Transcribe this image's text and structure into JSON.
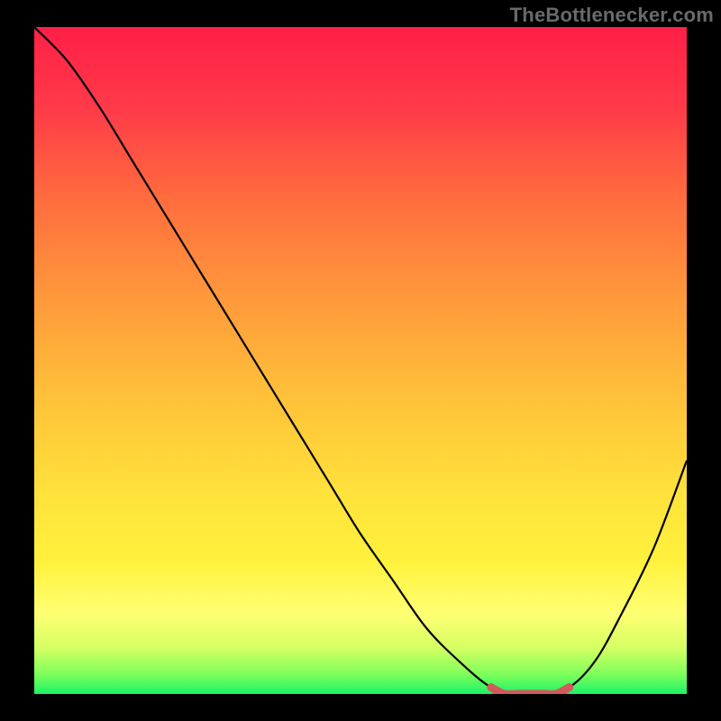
{
  "watermark": "TheBottlenecker.com",
  "chart_data": {
    "type": "line",
    "title": "",
    "xlabel": "",
    "ylabel": "",
    "xlim": [
      0,
      100
    ],
    "ylim": [
      0,
      100
    ],
    "series": [
      {
        "name": "bottleneck-curve",
        "x": [
          0,
          5,
          10,
          15,
          20,
          25,
          30,
          35,
          40,
          45,
          50,
          55,
          60,
          65,
          70,
          74,
          78,
          82,
          86,
          90,
          95,
          100
        ],
        "y": [
          100,
          95,
          88,
          80,
          72,
          64,
          56,
          48,
          40,
          32,
          24,
          17,
          10,
          5,
          1,
          0,
          0,
          1,
          5,
          12,
          22,
          35
        ]
      },
      {
        "name": "highlight-flat-bottom",
        "x": [
          70,
          72,
          74,
          76,
          78,
          80,
          82
        ],
        "y": [
          1,
          0,
          0,
          0,
          0,
          0,
          1
        ]
      }
    ],
    "gradient_stops": [
      {
        "pos": 0.0,
        "color": "#ff1f47"
      },
      {
        "pos": 0.12,
        "color": "#ff3a49"
      },
      {
        "pos": 0.25,
        "color": "#ff6a3e"
      },
      {
        "pos": 0.4,
        "color": "#ff973b"
      },
      {
        "pos": 0.55,
        "color": "#ffc03a"
      },
      {
        "pos": 0.7,
        "color": "#ffe23b"
      },
      {
        "pos": 0.8,
        "color": "#fff13c"
      },
      {
        "pos": 0.88,
        "color": "#ffff73"
      },
      {
        "pos": 0.93,
        "color": "#d6ff63"
      },
      {
        "pos": 0.97,
        "color": "#7fff5a"
      },
      {
        "pos": 1.0,
        "color": "#1cf268"
      }
    ]
  }
}
